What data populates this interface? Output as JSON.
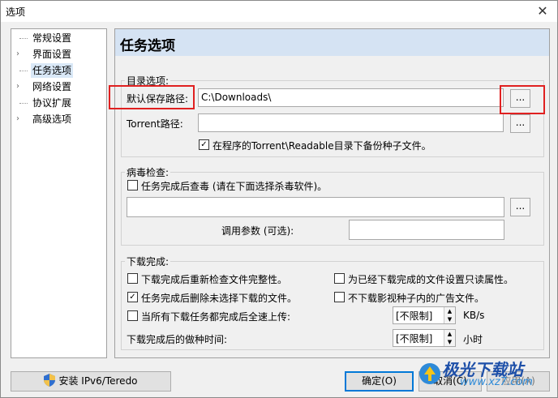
{
  "window": {
    "title": "选项",
    "close_glyph": "✕"
  },
  "tree": {
    "items": [
      {
        "label": "常规设置",
        "expandable": false,
        "selected": false
      },
      {
        "label": "界面设置",
        "expandable": true,
        "selected": false
      },
      {
        "label": "任务选项",
        "expandable": false,
        "selected": true
      },
      {
        "label": "网络设置",
        "expandable": true,
        "selected": false
      },
      {
        "label": "协议扩展",
        "expandable": false,
        "selected": false
      },
      {
        "label": "高级选项",
        "expandable": true,
        "selected": false
      }
    ]
  },
  "panel": {
    "title": "任务选项",
    "dir_group": {
      "title": "目录选项:",
      "default_path_label": "默认保存路径:",
      "default_path_value": "C:\\Downloads\\",
      "torrent_path_label": "Torrent路径:",
      "torrent_path_value": "",
      "browse_label": "...",
      "backup_checkbox_label": "在程序的Torrent\\Readable目录下备份种子文件。",
      "backup_checked": true
    },
    "virus_group": {
      "title": "病毒检查:",
      "scan_checkbox_label": "任务完成后查毒 (请在下面选择杀毒软件)。",
      "scan_checked": false,
      "scanner_path_value": "",
      "browse_label": "...",
      "params_label": "调用参数 (可选):",
      "params_value": ""
    },
    "done_group": {
      "title": "下载完成:",
      "recheck_label": "下载完成后重新检查文件完整性。",
      "recheck_checked": false,
      "readonly_label": "为已经下载完成的文件设置只读属性。",
      "readonly_checked": false,
      "delete_unselected_label": "任务完成后删除未选择下载的文件。",
      "delete_unselected_checked": true,
      "no_ads_label": "不下载影视种子内的广告文件。",
      "no_ads_checked": false,
      "full_upload_label": "当所有下载任务都完成后全速上传:",
      "full_upload_checked": false,
      "upload_limit_value": "[不限制]",
      "upload_unit": "KB/s",
      "seed_time_label": "下载完成后的做种时间:",
      "seed_time_value": "[不限制]",
      "seed_time_unit": "小时"
    }
  },
  "footer": {
    "install_label": "安装 IPv6/Teredo",
    "ok_label": "确定(O)",
    "cancel_label": "取消(C)",
    "apply_label": "应用(A)"
  },
  "watermark": {
    "main": "极光下载站",
    "sub": "www.xz7.com"
  },
  "colors": {
    "highlight_red": "#e02020",
    "header_blue": "#d5e3f3",
    "primary_border": "#0078d7"
  }
}
